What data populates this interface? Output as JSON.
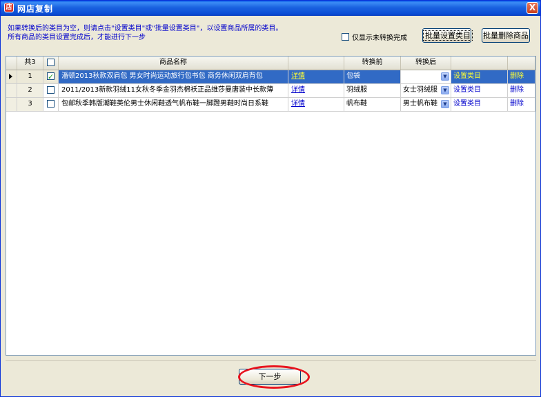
{
  "window": {
    "title": "网店复制",
    "close_glyph": "X",
    "app_icon_glyph": "店"
  },
  "hints": {
    "line1": "如果转换后的类目为空，则请点击\"设置类目\"或\"批量设置类目\"，以设置商品所属的类目。",
    "line2": "所有商品的类目设置完成后，才能进行下一步"
  },
  "filter": {
    "label": "仅显示未转换完成",
    "checked": false
  },
  "toolbar": {
    "batch_set_label": "批量设置类目",
    "batch_delete_label": "批量删除商品"
  },
  "table": {
    "columns": {
      "count": "共3",
      "name": "商品名称",
      "before": "转换前",
      "after": "转换后"
    },
    "rows": [
      {
        "num": "1",
        "checked": true,
        "name": "潘顿2013秋款双肩包 男女时尚运动旅行包书包 商务休闲双肩背包",
        "detail": "详情",
        "before": "包袋",
        "after": "",
        "set": "设置类目",
        "delete": "删除"
      },
      {
        "num": "2",
        "checked": false,
        "name": "2011/2013新款羽绒11女秋冬季金羽杰棉袄正品维莎曼唐装中长款薄",
        "detail": "详情",
        "before": "羽绒服",
        "after": "女士羽绒服",
        "set": "设置类目",
        "delete": "删除"
      },
      {
        "num": "3",
        "checked": false,
        "name": "包邮秋季韩版潮鞋英伦男士休闲鞋透气帆布鞋一脚蹬男鞋时尚日系鞋",
        "detail": "详情",
        "before": "帆布鞋",
        "after": "男士帆布鞋",
        "set": "设置类目",
        "delete": "删除"
      }
    ]
  },
  "footer": {
    "next_label": "下一步"
  },
  "colors": {
    "selection": "#316ac5",
    "link": "#0000cc",
    "highlight_ring": "#e8141e",
    "titlebar": "#0a5ce8"
  }
}
